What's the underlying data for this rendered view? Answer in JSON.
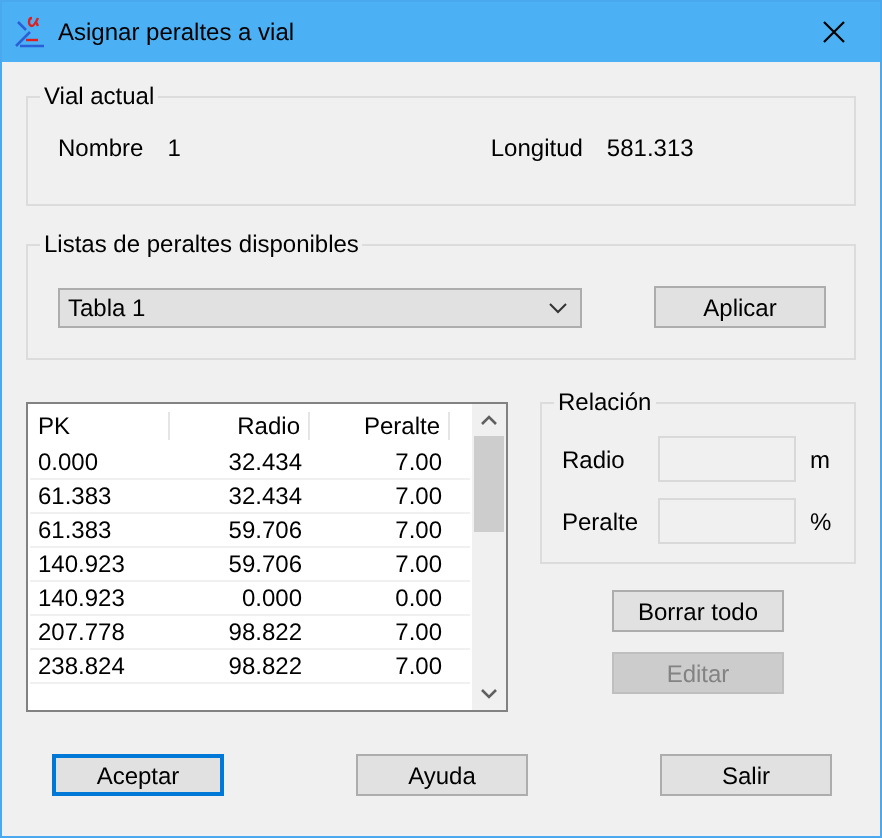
{
  "window": {
    "title": "Asignar peraltes a vial"
  },
  "vial_actual": {
    "title": "Vial actual",
    "nombre_label": "Nombre",
    "nombre_value": "1",
    "longitud_label": "Longitud",
    "longitud_value": "581.313"
  },
  "listas": {
    "title": "Listas de peraltes disponibles",
    "dropdown": {
      "value": "Tabla 1"
    },
    "apply_button": "Aplicar"
  },
  "table": {
    "columns": [
      "PK",
      "Radio",
      "Peralte"
    ],
    "rows": [
      [
        "0.000",
        "32.434",
        "7.00"
      ],
      [
        "61.383",
        "32.434",
        "7.00"
      ],
      [
        "61.383",
        "59.706",
        "7.00"
      ],
      [
        "140.923",
        "59.706",
        "7.00"
      ],
      [
        "140.923",
        "0.000",
        "0.00"
      ],
      [
        "207.778",
        "98.822",
        "7.00"
      ],
      [
        "238.824",
        "98.822",
        "7.00"
      ]
    ]
  },
  "relacion": {
    "title": "Relación",
    "fields": [
      {
        "label": "Radio",
        "unit": "m"
      },
      {
        "label": "Peralte",
        "unit": "%"
      }
    ]
  },
  "side_buttons": [
    {
      "label": "Borrar todo",
      "disabled": false
    },
    {
      "label": "Editar",
      "disabled": true
    }
  ],
  "footer_buttons": [
    {
      "label": "Aceptar",
      "focused": true
    },
    {
      "label": "Ayuda",
      "focused": false
    },
    {
      "label": "Salir",
      "focused": false
    }
  ]
}
